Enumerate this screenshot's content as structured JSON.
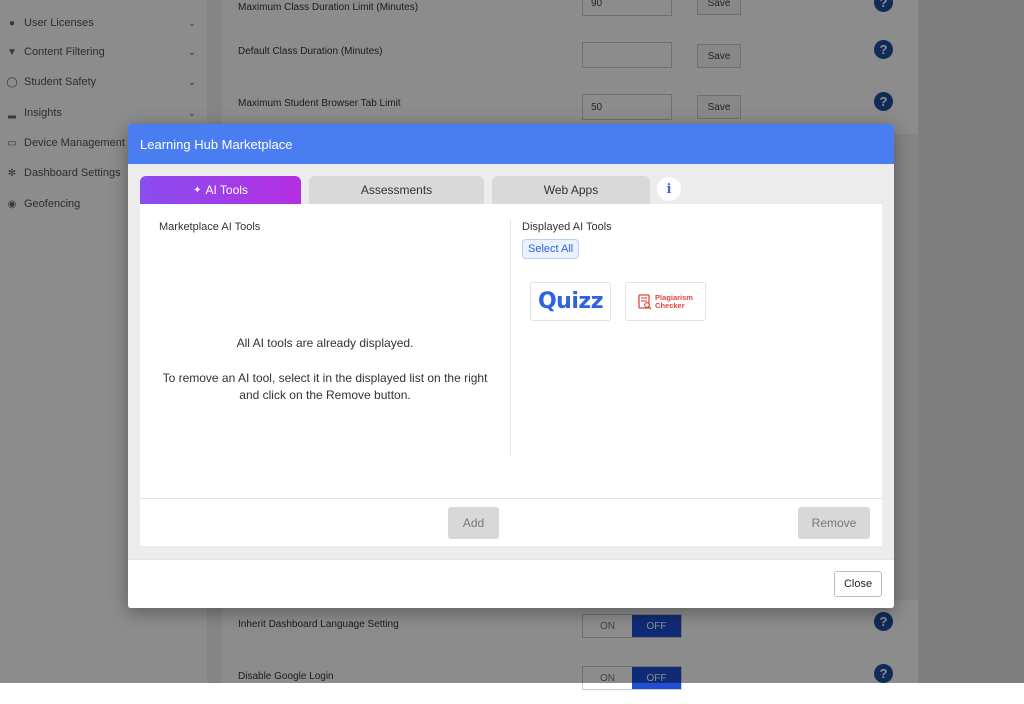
{
  "sidebar": {
    "items": [
      {
        "label": "User Licenses",
        "icon": "user-icon"
      },
      {
        "label": "Content Filtering",
        "icon": "filter-icon"
      },
      {
        "label": "Student Safety",
        "icon": "shield-icon"
      },
      {
        "label": "Insights",
        "icon": "bar-chart-icon"
      },
      {
        "label": "Device Management",
        "icon": "monitor-icon"
      },
      {
        "label": "Dashboard Settings",
        "icon": "gear-icon"
      },
      {
        "label": "Geofencing",
        "icon": "location-pin-icon"
      }
    ]
  },
  "settings": {
    "row1": {
      "label": "Maximum Class Duration Limit (Minutes)",
      "value": "90",
      "save": "Save"
    },
    "row2": {
      "label": "Default Class Duration (Minutes)",
      "value": "",
      "save": "Save"
    },
    "row3": {
      "label": "Maximum Student Browser Tab Limit",
      "value": "50",
      "save": "Save"
    },
    "row4": {
      "label": "Inherit Dashboard Language Setting",
      "on": "ON",
      "off": "OFF"
    },
    "row5": {
      "label": "Disable Google Login",
      "on": "ON",
      "off": "OFF"
    },
    "help_glyph": "?"
  },
  "modal": {
    "title": "Learning Hub Marketplace",
    "tabs": [
      {
        "label": "AI Tools",
        "icon": "sparkle-icon",
        "active": true
      },
      {
        "label": "Assessments",
        "active": false
      },
      {
        "label": "Web Apps",
        "active": false
      }
    ],
    "info_glyph": "i",
    "left": {
      "title": "Marketplace AI Tools",
      "empty_line1": "All AI tools are already displayed.",
      "empty_line2": "To remove an AI tool, select it in the displayed list on the right",
      "empty_line3": "and click on the Remove button."
    },
    "right": {
      "title": "Displayed AI Tools",
      "select_all": "Select All",
      "tools": [
        {
          "name": "Quizz",
          "logo": "quizz-logo"
        },
        {
          "name_line1": "Plagiarism",
          "name_line2": "Checker",
          "logo": "plagiarism-checker-logo"
        }
      ]
    },
    "add_button": "Add",
    "remove_button": "Remove",
    "close_button": "Close"
  },
  "colors": {
    "header": "#4a7df0",
    "tab_active_start": "#8a4df0",
    "tab_active_end": "#b42fe0",
    "toggle_off": "#1e4fd6"
  }
}
